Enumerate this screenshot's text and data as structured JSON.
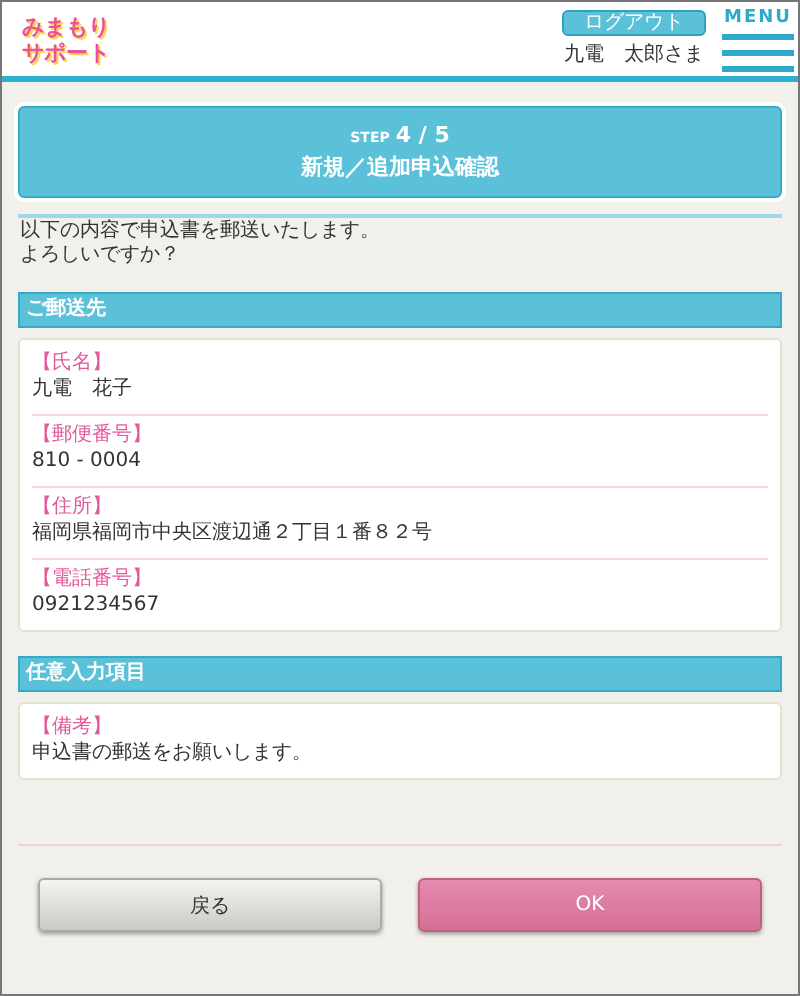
{
  "header": {
    "logo_lines": [
      "みまもり",
      "サポート"
    ],
    "logout_button": "ログアウト",
    "user_name": "九電　太郎さま",
    "menu_label": "MENU"
  },
  "step": {
    "prefix": "STEP",
    "number": "4 / 5",
    "title": "新規／追加申込確認"
  },
  "intro": [
    "以下の内容で申込書を郵送いたします。",
    "よろしいですか？"
  ],
  "sections": [
    {
      "title": "ご郵送先",
      "fields": [
        {
          "label": "【氏名】",
          "value": "九電　花子"
        },
        {
          "label": "【郵便番号】",
          "value": "810 - 0004"
        },
        {
          "label": "【住所】",
          "value": "福岡県福岡市中央区渡辺通２丁目１番８２号"
        },
        {
          "label": "【電話番号】",
          "value": "0921234567"
        }
      ]
    },
    {
      "title": "任意入力項目",
      "fields": [
        {
          "label": "【備考】",
          "value": "申込書の郵送をお願いします。"
        }
      ]
    }
  ],
  "buttons": [
    {
      "label": "戻る",
      "kind": "secondary"
    },
    {
      "label": "OK",
      "kind": "primary"
    }
  ]
}
